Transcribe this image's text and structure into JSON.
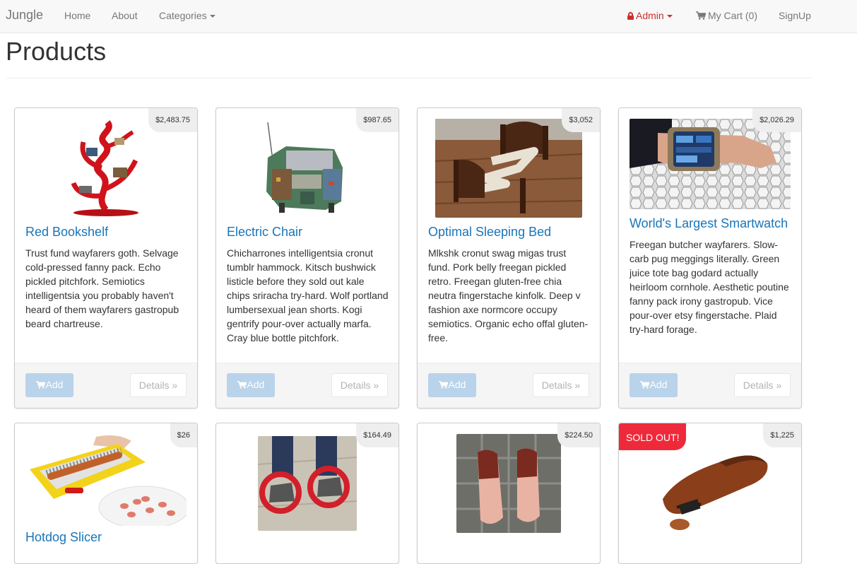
{
  "nav": {
    "brand": "Jungle",
    "links": [
      "Home",
      "About",
      "Categories"
    ],
    "admin": "Admin",
    "cart": "My Cart (0)",
    "signup": "SignUp"
  },
  "page": {
    "title": "Products"
  },
  "button_labels": {
    "add": "Add",
    "details": "Details »"
  },
  "soldout_label": "SOLD OUT!",
  "products": [
    {
      "name": "Red Bookshelf",
      "price": "$2,483.75",
      "image": "red-bookshelf-photo",
      "description": "Trust fund wayfarers goth. Selvage cold-pressed fanny pack. Echo pickled pitchfork. Semiotics intelligentsia you probably haven't heard of them wayfarers gastropub beard chartreuse."
    },
    {
      "name": "Electric Chair",
      "price": "$987.65",
      "image": "circuit-board-chair-photo",
      "description": "Chicharrones intelligentsia cronut tumblr hammock. Kitsch bushwick listicle before they sold out kale chips sriracha try-hard. Wolf portland lumbersexual jean shorts. Kogi gentrify pour-over actually marfa. Cray blue bottle pitchfork."
    },
    {
      "name": "Optimal Sleeping Bed",
      "price": "$3,052",
      "image": "zigzag-bed-photo",
      "description": "Mlkshk cronut swag migas trust fund. Pork belly freegan pickled retro. Freegan gluten-free chia neutra fingerstache kinfolk. Deep v fashion axe normcore occupy semiotics. Organic echo offal gluten-free."
    },
    {
      "name": "World's Largest Smartwatch",
      "price": "$2,026.29",
      "image": "wrist-smartwatch-photo",
      "description": "Freegan butcher wayfarers. Slow-carb pug meggings literally. Green juice tote bag godard actually heirloom cornhole. Aesthetic poutine fanny pack irony gastropub. Vice pour-over etsy fingerstache. Plaid try-hard forage."
    },
    {
      "name": "Hotdog Slicer",
      "price": "$26",
      "image": "hotdog-slicer-photo"
    },
    {
      "price": "$164.49",
      "image": "wheel-skates-photo"
    },
    {
      "price": "$224.50",
      "image": "feet-shoes-photo"
    },
    {
      "price": "$1,225",
      "image": "leather-shoe-photo",
      "sold_out": true
    }
  ]
}
